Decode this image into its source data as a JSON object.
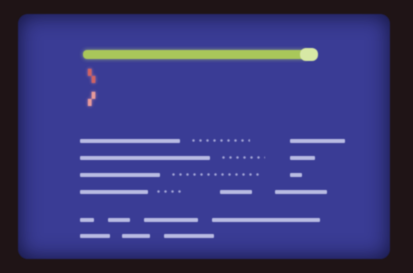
{
  "screen": {
    "title_bar": "",
    "accent_color": "#a9c75a",
    "background_color": "#3a3c95"
  },
  "sprites": [
    {
      "icon": "player-sprite-icon",
      "color": "#d06262"
    },
    {
      "icon": "player-sprite-icon",
      "color": "#e89a9a"
    }
  ],
  "stats": [
    {
      "label": "",
      "value": ""
    },
    {
      "label": "",
      "value": ""
    },
    {
      "label": "",
      "value": ""
    },
    {
      "label": "",
      "value": ""
    }
  ],
  "messages": [
    "",
    ""
  ]
}
